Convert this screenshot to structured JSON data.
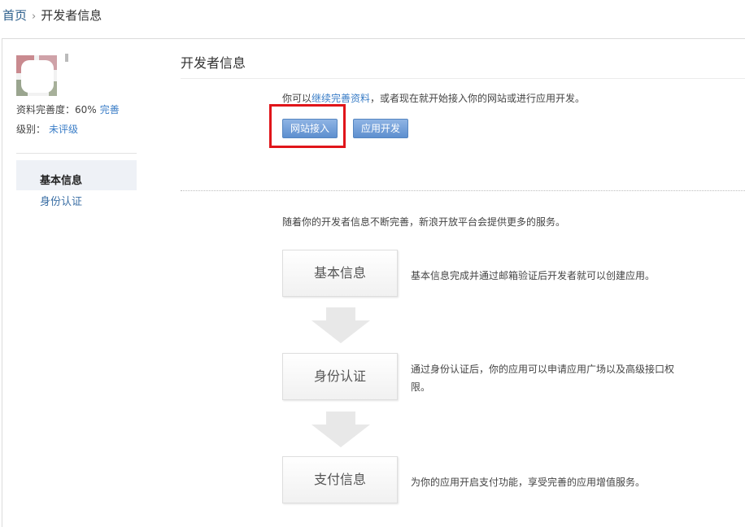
{
  "breadcrumb": {
    "home": "首页",
    "separator": "›",
    "current": "开发者信息"
  },
  "profile": {
    "completeness_label": "资料完善度：60%",
    "complete_link": "完善",
    "level_label": "级别：",
    "level_value": "未评级"
  },
  "sidebar": {
    "items": [
      {
        "label": "基本信息",
        "active": true
      },
      {
        "label": "身份认证",
        "active": false
      }
    ]
  },
  "main": {
    "title": "开发者信息",
    "intro_prefix": "你可以",
    "intro_link": "继续完善资料",
    "intro_suffix": "，或者现在就开始接入你的网站或进行应用开发。",
    "buttons": {
      "website": "网站接入",
      "app": "应用开发"
    },
    "description": "随着你的开发者信息不断完善，新浪开放平台会提供更多的服务。",
    "steps": [
      {
        "title": "基本信息",
        "text": "基本信息完成并通过邮箱验证后开发者就可以创建应用。"
      },
      {
        "title": "身份认证",
        "text_line1": "通过身份认证后，你的应用可以申请应用广场以及高级接口权",
        "text_line2": "限。"
      },
      {
        "title": "支付信息",
        "text": "为你的应用开启支付功能，享受完善的应用增值服务。"
      }
    ]
  },
  "colors": {
    "link": "#3b7ec7",
    "button": "#5d8fcf",
    "highlight": "#e0151a"
  },
  "icons": {
    "step_arrow": "down-arrow-icon"
  }
}
